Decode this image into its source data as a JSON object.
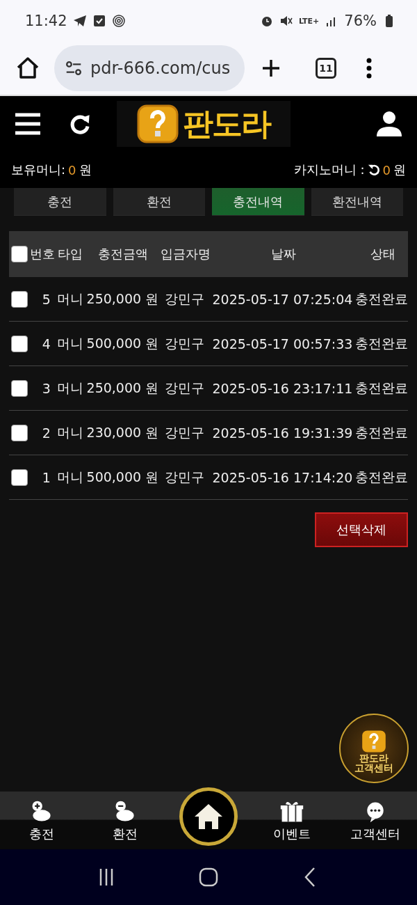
{
  "status_bar": {
    "time": "11:42",
    "network": "LTE+",
    "battery": "76%"
  },
  "browser": {
    "url": "pdr-666.com/cus",
    "tab_count": "11"
  },
  "header": {
    "logo_text": "판도라"
  },
  "balances": [
    {
      "kind": "wallet",
      "label": "보유머니:",
      "amount": "0",
      "unit": "원"
    },
    {
      "kind": "casino",
      "label": "카지노머니 :",
      "amount": "0",
      "unit": "원"
    }
  ],
  "tabs": [
    {
      "label": "충전",
      "selected": false
    },
    {
      "label": "환전",
      "selected": false
    },
    {
      "label": "충전내역",
      "selected": true
    },
    {
      "label": "환전내역",
      "selected": false
    }
  ],
  "table": {
    "select_all": {
      "checked": false
    },
    "columns": [
      "번호",
      "타입",
      "충전금액",
      "입금자명",
      "날짜",
      "상태"
    ],
    "rows": [
      {
        "checked": false,
        "cells": [
          "5",
          "머니",
          "250,000 원",
          "강민구",
          "2025-05-17 07:25:04",
          "충전완료"
        ]
      },
      {
        "checked": false,
        "cells": [
          "4",
          "머니",
          "500,000 원",
          "강민구",
          "2025-05-17 00:57:33",
          "충전완료"
        ]
      },
      {
        "checked": false,
        "cells": [
          "3",
          "머니",
          "250,000 원",
          "강민구",
          "2025-05-16 23:17:11",
          "충전완료"
        ]
      },
      {
        "checked": false,
        "cells": [
          "2",
          "머니",
          "230,000 원",
          "강민구",
          "2025-05-16 19:31:39",
          "충전완료"
        ]
      },
      {
        "checked": false,
        "cells": [
          "1",
          "머니",
          "500,000 원",
          "강민구",
          "2025-05-16 17:14:20",
          "충전완료"
        ]
      }
    ]
  },
  "delete_button": {
    "label": "선택삭제"
  },
  "support_badge": {
    "lines": [
      "판도라",
      "고객센터"
    ]
  },
  "bottom_nav": [
    {
      "kind": "deposit",
      "label": "충전"
    },
    {
      "kind": "withdraw",
      "label": "환전"
    },
    {
      "kind": "home"
    },
    {
      "kind": "event",
      "label": "이벤트"
    },
    {
      "kind": "support",
      "label": "고객센터"
    }
  ]
}
